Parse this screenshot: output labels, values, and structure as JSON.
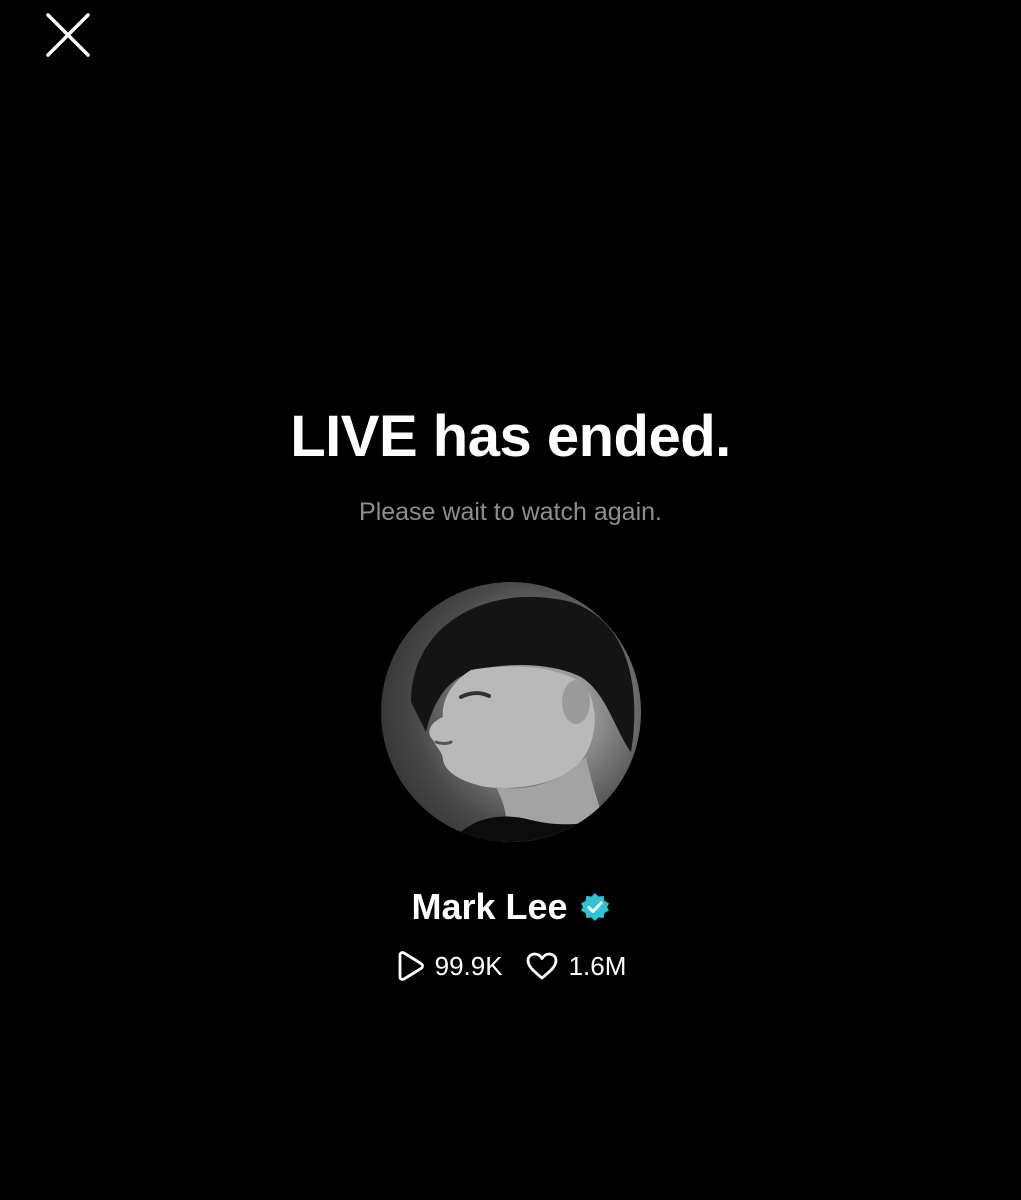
{
  "close_icon": "close-icon",
  "status": {
    "title": "LIVE has ended.",
    "subtitle": "Please wait to watch again."
  },
  "profile": {
    "name": "Mark Lee",
    "verified_icon": "verified-badge-icon",
    "verified_color": "#2ec4d6"
  },
  "stats": {
    "plays_icon": "play-icon",
    "plays": "99.9K",
    "likes_icon": "heart-icon",
    "likes": "1.6M"
  }
}
